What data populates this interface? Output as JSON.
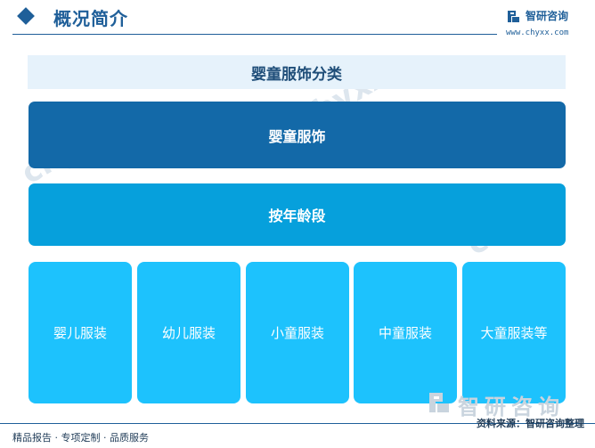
{
  "header": {
    "title": "概况简介",
    "logo_name": "智研咨询",
    "logo_url": "www.chyxx.com"
  },
  "diagram": {
    "title": "婴童服饰分类",
    "root": "婴童服饰",
    "criterion": "按年龄段",
    "leaves": [
      "婴儿服装",
      "幼儿服装",
      "小童服装",
      "中童服装",
      "大童服装等"
    ]
  },
  "footer": {
    "left": "精品报告 · 专项定制 · 品质服务",
    "source": "资料来源：智研咨询整理",
    "brand": "智研咨询"
  },
  "colors": {
    "brand": "#1f5f99",
    "level_1": "#1369a8",
    "level_2": "#06a0dc",
    "leaf": "#1dc2fd",
    "title_band": "#e6f2fb"
  },
  "icons": {
    "header_marker": "diamond-icon",
    "logo": "chyxx-logo-icon"
  }
}
